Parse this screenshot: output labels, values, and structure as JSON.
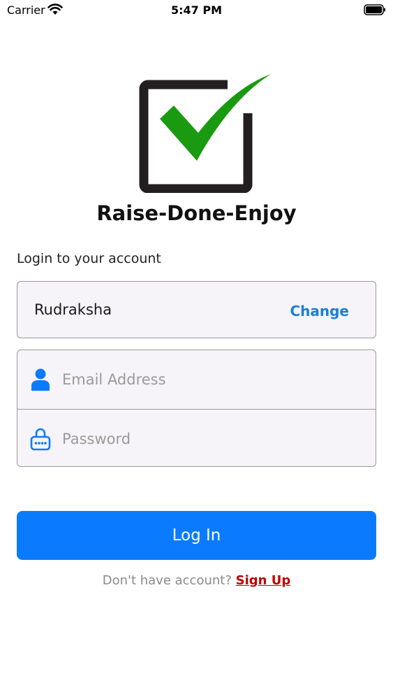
{
  "status_bar": {
    "carrier": "Carrier",
    "time": "5:47 PM"
  },
  "app": {
    "title": "Raise-Done-Enjoy"
  },
  "login": {
    "heading": "Login to your account",
    "account_name": "Rudraksha",
    "change_label": "Change",
    "email_placeholder": "Email Address",
    "password_placeholder": "Password",
    "login_button_label": "Log In",
    "signup_prompt": "Don't have account?",
    "signup_label": "Sign Up"
  },
  "colors": {
    "accent": "#0a7bff",
    "link_blue": "#1a7fd6",
    "signup_red": "#c00000",
    "check_green": "#1a9a10"
  }
}
